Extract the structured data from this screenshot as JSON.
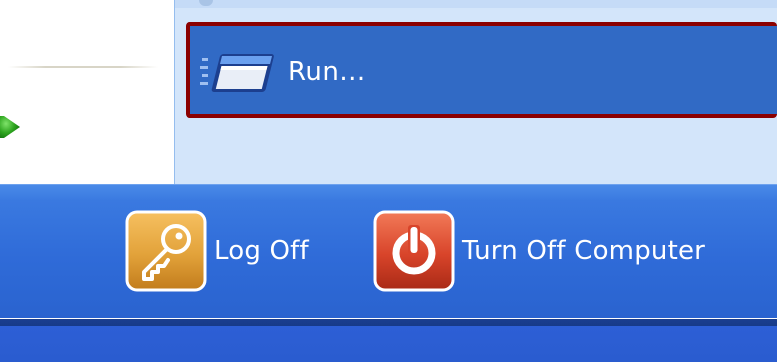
{
  "start_menu": {
    "right_pane": {
      "items": [
        {
          "label": "Run...",
          "icon": "run-window-icon",
          "selected": true
        }
      ]
    },
    "footer": {
      "log_off_label": "Log Off",
      "log_off_icon": "key-icon",
      "turn_off_label": "Turn Off Computer",
      "turn_off_icon": "power-icon"
    }
  },
  "colors": {
    "selection_highlight": "#316ac5",
    "selection_outline": "#8b0000",
    "right_pane_bg": "#d3e5fa",
    "footer_bar": "#2f6bd8",
    "log_off_icon_bg": "#e2a23a",
    "turn_off_icon_bg": "#d8442a"
  }
}
